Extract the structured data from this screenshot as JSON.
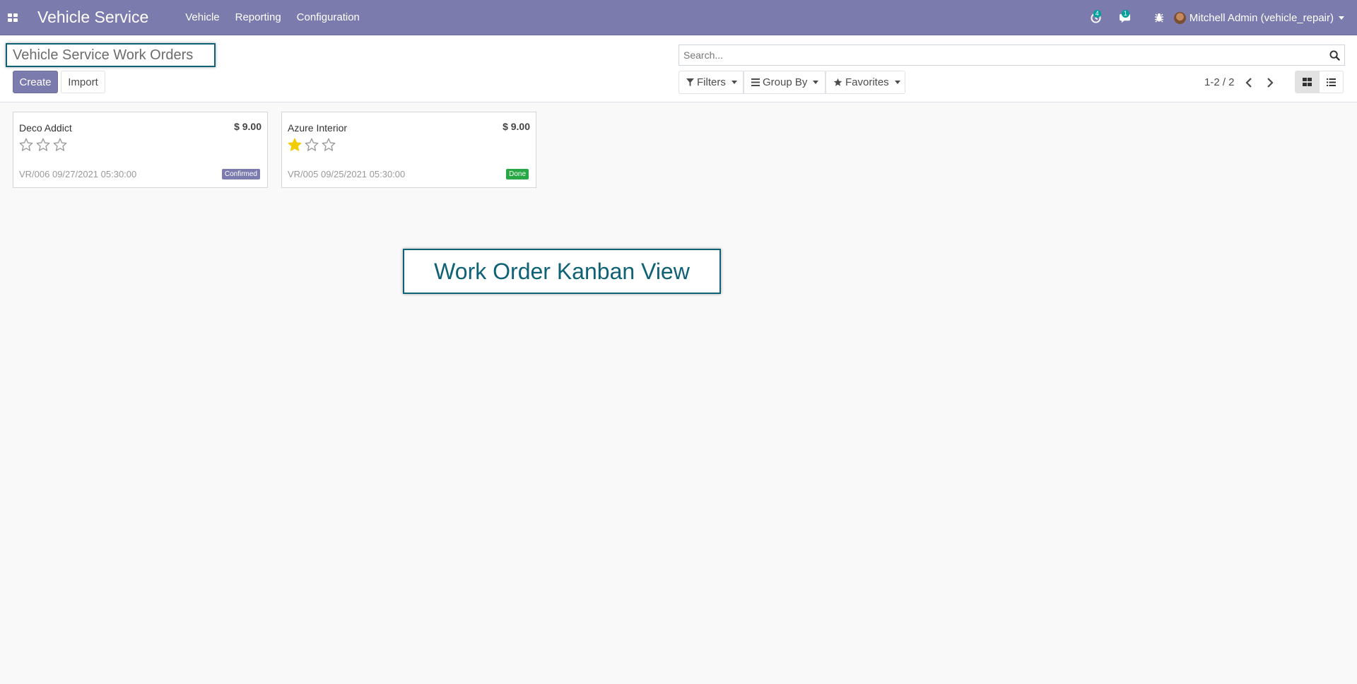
{
  "navbar": {
    "app_title": "Vehicle Service",
    "menu": [
      "Vehicle",
      "Reporting",
      "Configuration"
    ],
    "activity_count": "4",
    "message_count": "1",
    "user_name": "Mitchell Admin (vehicle_repair)",
    "bg_color": "#7c7bad"
  },
  "control_panel": {
    "page_title": "Vehicle Service Work Orders",
    "create_label": "Create",
    "import_label": "Import",
    "search_placeholder": "Search...",
    "filters_label": "Filters",
    "group_by_label": "Group By",
    "favorites_label": "Favorites",
    "pager": "1-2 / 2"
  },
  "cards": [
    {
      "name": "Deco Addict",
      "price": "$ 9.00",
      "stars_filled": 0,
      "reference": "VR/006 09/27/2021 05:30:00",
      "status": "Confirmed",
      "status_color": "#7c7bad"
    },
    {
      "name": "Azure Interior",
      "price": "$ 9.00",
      "stars_filled": 1,
      "reference": "VR/005 09/25/2021 05:30:00",
      "status": "Done",
      "status_color": "#28a745"
    }
  ],
  "annotation": {
    "text": "Work Order Kanban View"
  },
  "icons": {
    "apps": "apps-grid-icon",
    "activity": "activity-clock-icon",
    "messages": "chat-icon",
    "debug": "bug-icon",
    "search": "search-icon",
    "filter": "filter-funnel-icon",
    "group_by": "list-bars-icon",
    "favorites": "star-icon",
    "prev": "chevron-left-icon",
    "next": "chevron-right-icon",
    "kanban": "kanban-grid-icon",
    "list": "list-view-icon"
  }
}
